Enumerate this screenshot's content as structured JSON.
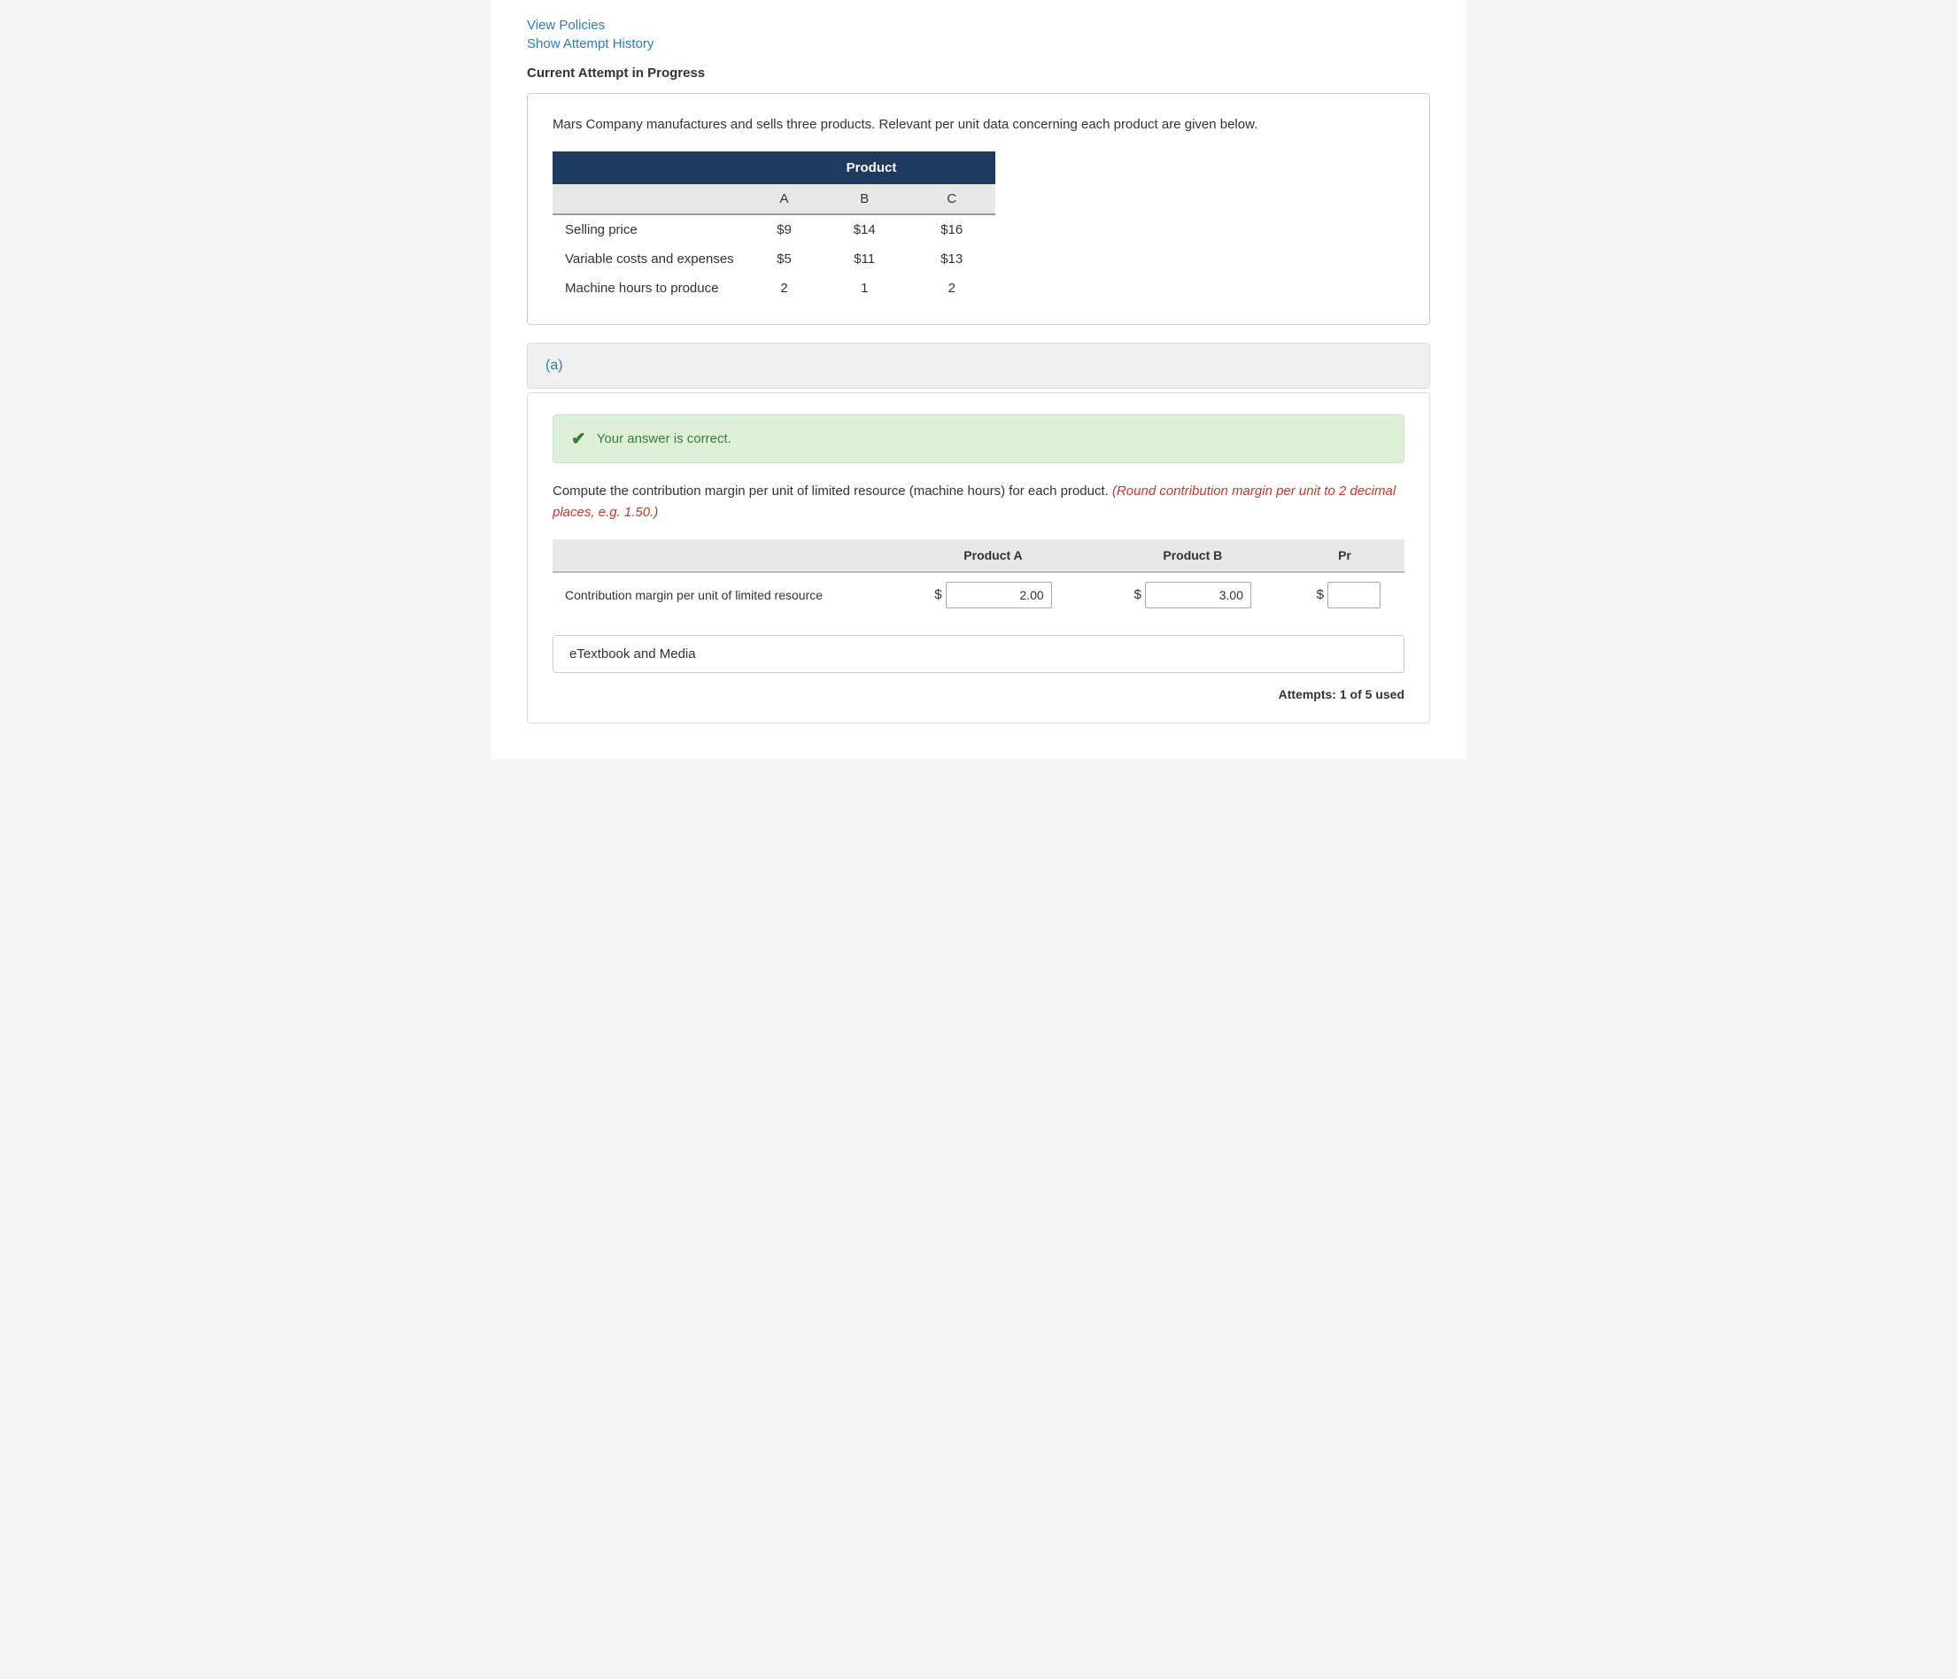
{
  "links": {
    "view_policies": "View Policies",
    "show_attempt_history": "Show Attempt History"
  },
  "current_attempt_label": "Current Attempt in Progress",
  "question_text": "Mars Company manufactures and sells three products. Relevant per unit data concerning each product are given below.",
  "product_table": {
    "header": "Product",
    "columns": [
      "",
      "A",
      "B",
      "C"
    ],
    "rows": [
      {
        "label": "Selling price",
        "a": "$9",
        "b": "$14",
        "c": "$16"
      },
      {
        "label": "Variable costs and expenses",
        "a": "$5",
        "b": "$11",
        "c": "$13"
      },
      {
        "label": "Machine hours to produce",
        "a": "2",
        "b": "1",
        "c": "2"
      }
    ]
  },
  "part_label": "(a)",
  "correct_banner": {
    "text": "Your answer is correct."
  },
  "compute_instruction": "Compute the contribution margin per unit of limited resource (machine hours) for each product.",
  "round_note": "(Round contribution margin per unit to 2 decimal places, e.g. 1.50.)",
  "answer_table": {
    "columns": [
      "",
      "Product A",
      "Product B",
      "Pr"
    ],
    "row_label": "Contribution margin per unit of limited resource",
    "values": {
      "a": "2.00",
      "b": "3.00",
      "c": ""
    },
    "dollar_signs": [
      "$",
      "$",
      "$"
    ]
  },
  "etextbook_button": "eTextbook and Media",
  "attempts_text": "Attempts: 1 of 5 used"
}
